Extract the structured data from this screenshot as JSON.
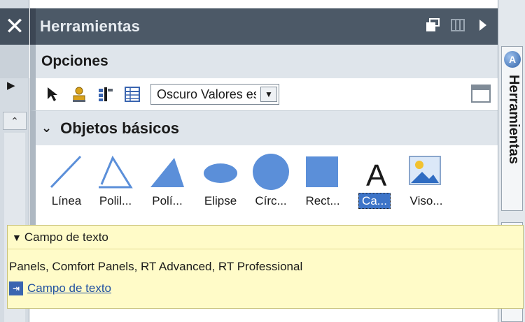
{
  "window": {
    "title": "Herramientas",
    "close_glyph": "✕",
    "title_icons": [
      "restore-icon",
      "columns-icon",
      "collapse-right-icon"
    ]
  },
  "options": {
    "label": "Opciones",
    "dropdown_value": "Oscuro Valores es",
    "toolbar_icons": [
      "pointer-icon",
      "person-icon",
      "properties-icon",
      "table-icon"
    ]
  },
  "section": {
    "title": "Objetos básicos",
    "expanded": true
  },
  "objects": [
    {
      "label": "Línea",
      "icon": "line-icon"
    },
    {
      "label": "Polil...",
      "icon": "polyline-icon"
    },
    {
      "label": "Polí...",
      "icon": "polygon-icon"
    },
    {
      "label": "Elipse",
      "icon": "ellipse-icon"
    },
    {
      "label": "Círc...",
      "icon": "circle-icon"
    },
    {
      "label": "Rect...",
      "icon": "rectangle-icon"
    },
    {
      "label": "Ca...",
      "icon": "text-field-icon",
      "selected": true
    },
    {
      "label": "Viso...",
      "icon": "image-viewer-icon"
    }
  ],
  "side_tab": {
    "label": "Herramientas"
  },
  "tooltip": {
    "title": "Campo de texto",
    "description": "Panels, Comfort Panels, RT Advanced, RT Professional",
    "link_text": "Campo de texto"
  },
  "colors": {
    "title_bar": "#4c5967",
    "section_bg": "#dfe5eb",
    "shape_fill": "#5b8fd9",
    "selection": "#3d74c8",
    "tooltip_bg": "#fffbc8"
  }
}
